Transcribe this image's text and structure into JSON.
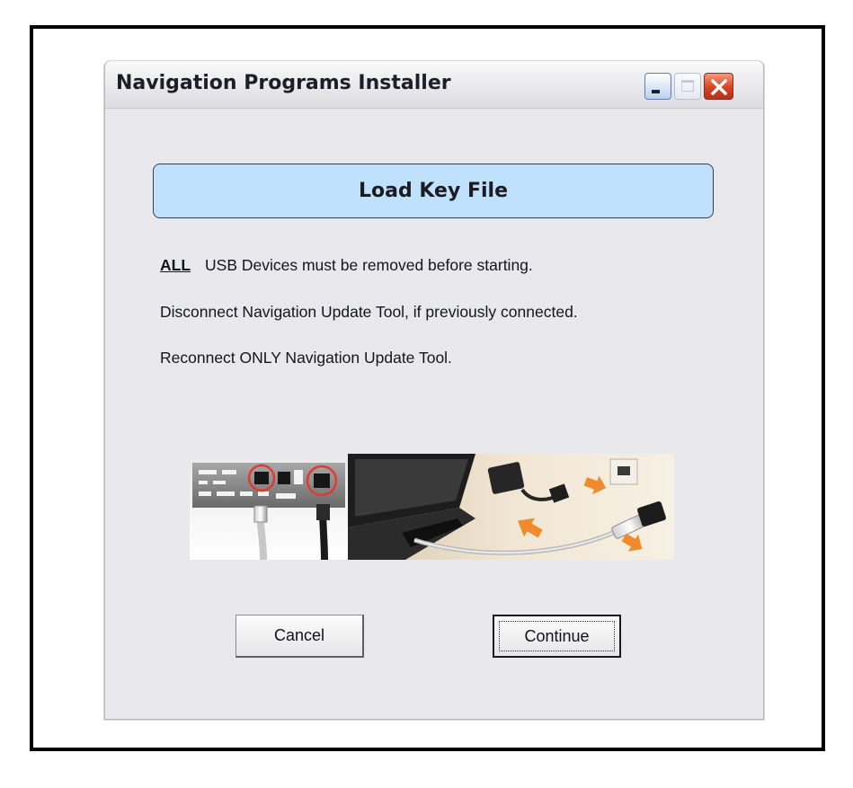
{
  "window": {
    "title": "Navigation Programs Installer",
    "controls": [
      "minimize-icon",
      "maximize-icon",
      "close-icon"
    ]
  },
  "dialog": {
    "header": "Load Key File",
    "instructions": {
      "line1_emphasis": "ALL",
      "line1_text": "USB Devices must be removed before starting.",
      "line2": "Disconnect Navigation Update Tool, if previously connected.",
      "line3": "Reconnect ONLY Navigation Update Tool."
    },
    "buttons": {
      "cancel": "Cancel",
      "continue": "Continue"
    }
  },
  "colors": {
    "header_fill": "#bfe1fb",
    "window_background": "#e8e8ed",
    "close_button": "#d6441f",
    "arrow_accent": "#f08a2c"
  }
}
